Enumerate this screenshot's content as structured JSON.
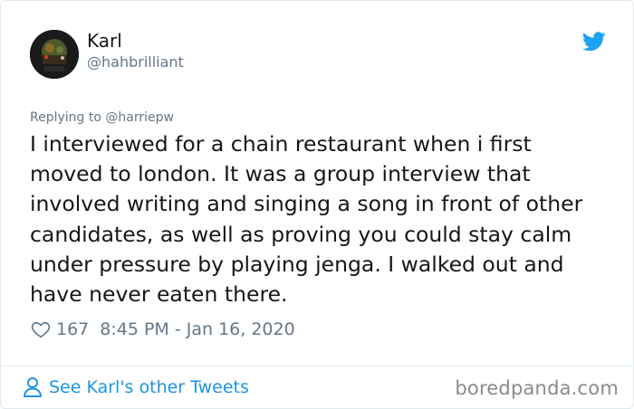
{
  "author": {
    "name": "Karl",
    "handle": "@hahbrilliant"
  },
  "tweet": {
    "reply_to": "Replying to @harriepw",
    "text": "I interviewed for a chain restaurant when i first\nmoved to london. It was a group interview that\ninvolved writing and  singing a song in front of other\ncandidates, as well as proving you could stay calm\nunder pressure by playing jenga. I walked out and\nhave never eaten there.",
    "likes": "167",
    "timestamp": "8:45 PM - Jan 16, 2020"
  },
  "footer": {
    "other_tweets_label": "See Karl's other Tweets"
  },
  "watermark": "boredpanda.com",
  "icons": {
    "brand": "twitter-bird-icon",
    "like": "heart-icon",
    "profile": "person-icon"
  },
  "colors": {
    "brand_blue": "#1da1f2",
    "link_blue": "#1b95e0",
    "secondary_text": "#657786",
    "primary_text": "#14171a",
    "border": "#e1e8ed"
  }
}
